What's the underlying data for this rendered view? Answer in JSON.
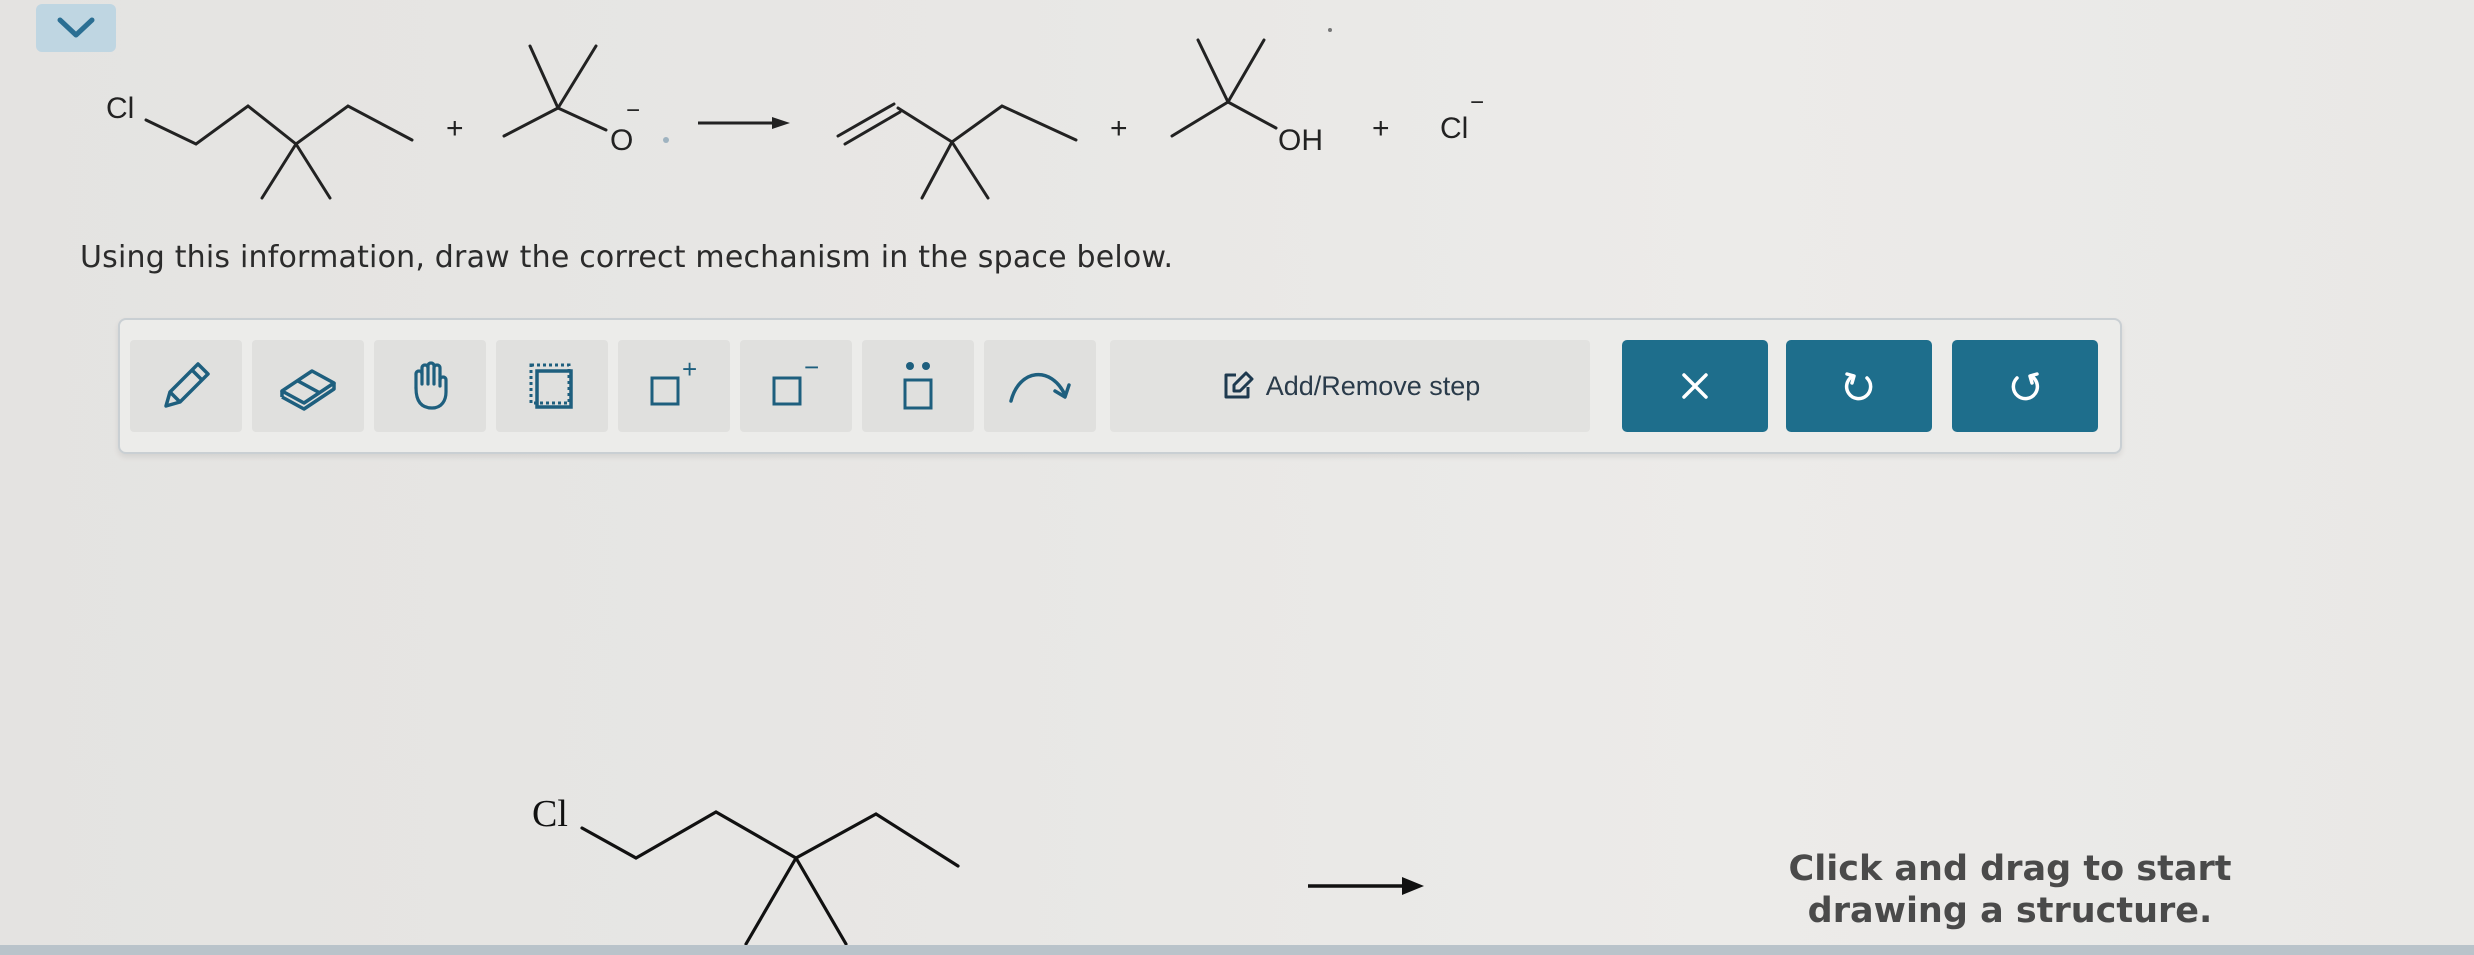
{
  "reaction": {
    "reactant_cl": "Cl",
    "plus_1": "+",
    "alkoxide_o": "O",
    "alkoxide_charge": "−",
    "plus_2": "+",
    "alcohol_oh": "OH",
    "plus_3": "+",
    "chloride": "Cl",
    "chloride_charge": "−"
  },
  "question": "Using this information, draw the correct mechanism in the space below.",
  "toolbar": {
    "tools": [
      "pencil-icon",
      "eraser-icon",
      "hand-icon",
      "selection-icon",
      "positive-charge-icon",
      "negative-charge-icon",
      "lone-pair-icon",
      "curved-arrow-icon"
    ],
    "positive_sign": "+",
    "negative_sign": "−",
    "step_label": "Add/Remove step",
    "clear_icon": "close-icon",
    "undo_icon": "undo-icon",
    "redo_icon": "redo-icon"
  },
  "canvas": {
    "structure_cl": "Cl",
    "hint": "Click and drag to start drawing a structure."
  },
  "colors": {
    "accent": "#1e6e8c",
    "collapse_bg": "#bfd6e2"
  }
}
